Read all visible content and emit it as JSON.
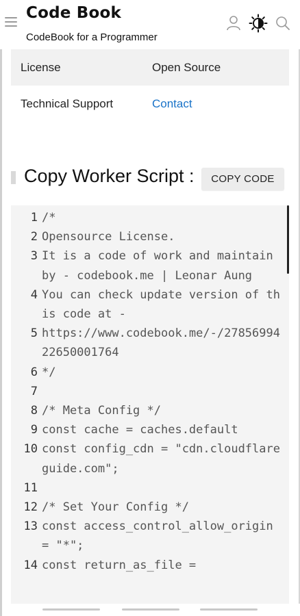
{
  "header": {
    "title": "Code Book",
    "tagline": "CodeBook for a Programmer"
  },
  "info_rows": [
    {
      "label": "License",
      "value": "Open Source",
      "is_link": false
    },
    {
      "label": "Technical Support",
      "value": "Contact",
      "is_link": true
    }
  ],
  "section": {
    "title": "Copy Worker Script :",
    "copy_button": "COPY CODE"
  },
  "code_lines": [
    {
      "num": "1",
      "text": "/*"
    },
    {
      "num": "2",
      "text": "Opensource License."
    },
    {
      "num": "3",
      "text": "It is a code of work and maintain by - codebook.me | Leonar Aung"
    },
    {
      "num": "4",
      "text": "You can check update version of this code at -"
    },
    {
      "num": "5",
      "text": "https://www.codebook.me/-/2785699422650001764"
    },
    {
      "num": "6",
      "text": "*/"
    },
    {
      "num": "7",
      "text": ""
    },
    {
      "num": "8",
      "text": "/* Meta Config */"
    },
    {
      "num": "9",
      "text": "const cache = caches.default"
    },
    {
      "num": "10",
      "text": "const config_cdn = \"cdn.cloudflareguide.com\";"
    },
    {
      "num": "11",
      "text": ""
    },
    {
      "num": "12",
      "text": "/* Set Your Config */"
    },
    {
      "num": "13",
      "text": "const access_control_allow_origin = \"*\";"
    },
    {
      "num": "14",
      "text": "const return_as_file ="
    }
  ],
  "colors": {
    "link": "#1a73c8",
    "row_shade": "#f1f1f1",
    "code_bg": "#f4f4f4",
    "button_bg": "#ececec"
  },
  "icons": [
    "menu-icon",
    "user-icon",
    "theme-toggle-icon",
    "search-icon"
  ]
}
